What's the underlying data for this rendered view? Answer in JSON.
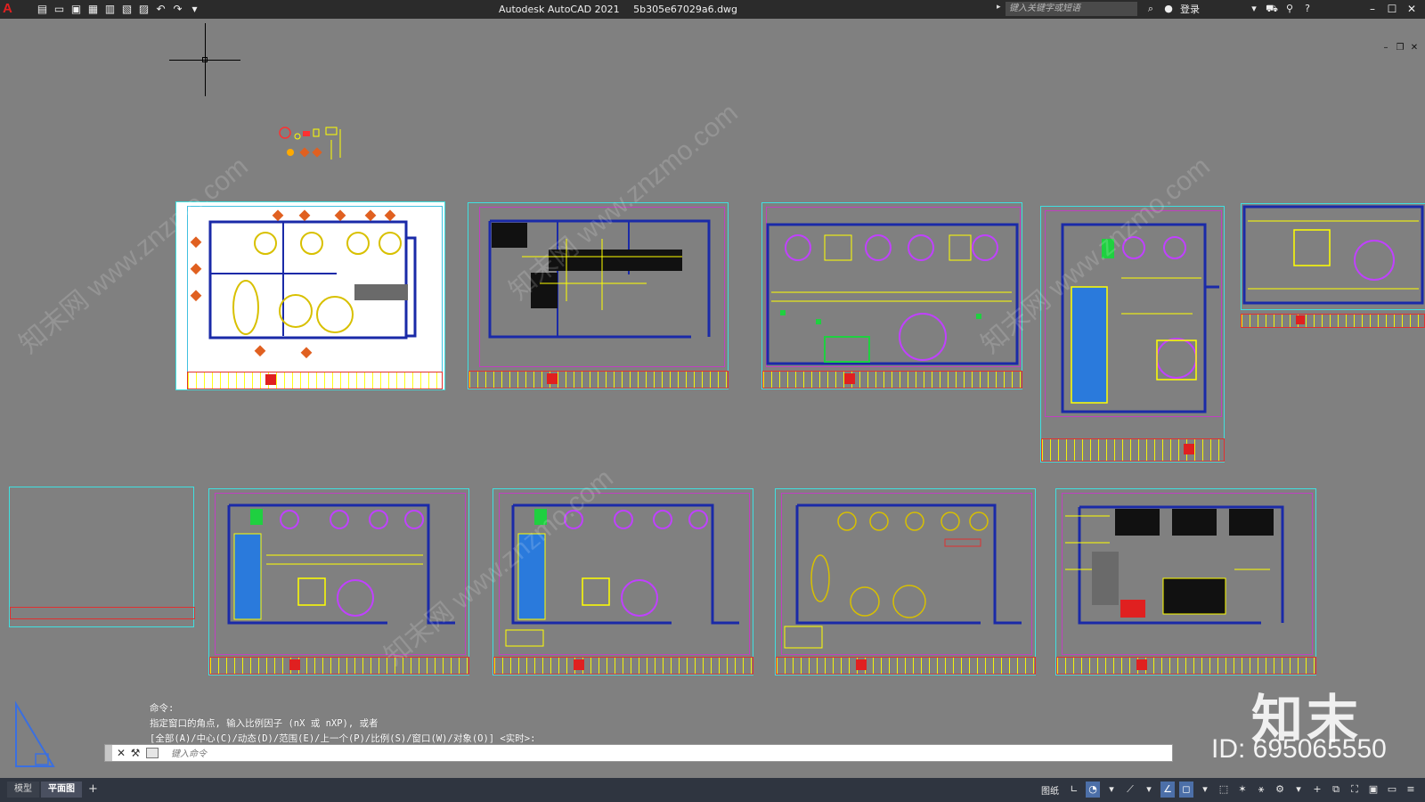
{
  "titlebar": {
    "app_name": "Autodesk AutoCAD 2021",
    "file_name": "5b305e67029a6.dwg",
    "search_placeholder": "键入关键字或短语",
    "login_label": "登录"
  },
  "quick_access": [
    "new-icon",
    "open-icon",
    "save-icon",
    "save-as-icon",
    "plot-icon",
    "undo-icon",
    "redo-icon"
  ],
  "command_line": {
    "history": [
      "命令:",
      "指定窗口的角点, 输入比例因子 (nX 或 nXP), 或者",
      "[全部(A)/中心(C)/动态(D)/范围(E)/上一个(P)/比例(S)/窗口(W)/对象(O)] <实时>:"
    ],
    "placeholder": "键入命令"
  },
  "tabs": {
    "model": "模型",
    "layout": "平面图",
    "add": "+"
  },
  "status": {
    "paper_label": "图纸"
  },
  "watermark": {
    "logo": "知末",
    "id": "ID: 695065550",
    "diag": "知末网 www.znzmo.com"
  },
  "colors": {
    "canvas": "#808080",
    "sheet_border": "#3fe0e0",
    "wall": "#1a2aa8",
    "annotation": "#ffff00",
    "title_red": "#e02020"
  }
}
